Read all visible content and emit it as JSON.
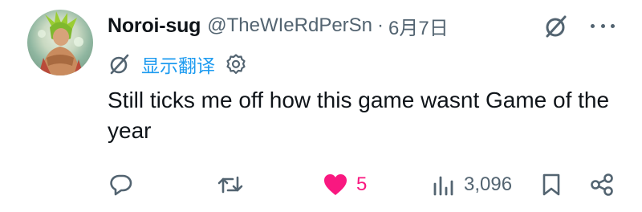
{
  "author": {
    "name": "Noroi-sug",
    "handle": "@TheWIeRdPerSn",
    "separator": "·",
    "date": "6月7日"
  },
  "translate": {
    "label": "显示翻译"
  },
  "tweet": {
    "text": "Still ticks me off how this game wasnt Game of the year"
  },
  "actions": {
    "reply_icon": "reply-icon",
    "retweet_icon": "retweet-icon",
    "like_icon": "heart-icon",
    "like_count": "5",
    "views_icon": "views-icon",
    "views_count": "3,096",
    "bookmark_icon": "bookmark-icon",
    "share_icon": "share-icon"
  },
  "colors": {
    "text": "#0f1419",
    "muted": "#536471",
    "link": "#1d9bf0",
    "like": "#f91880"
  }
}
